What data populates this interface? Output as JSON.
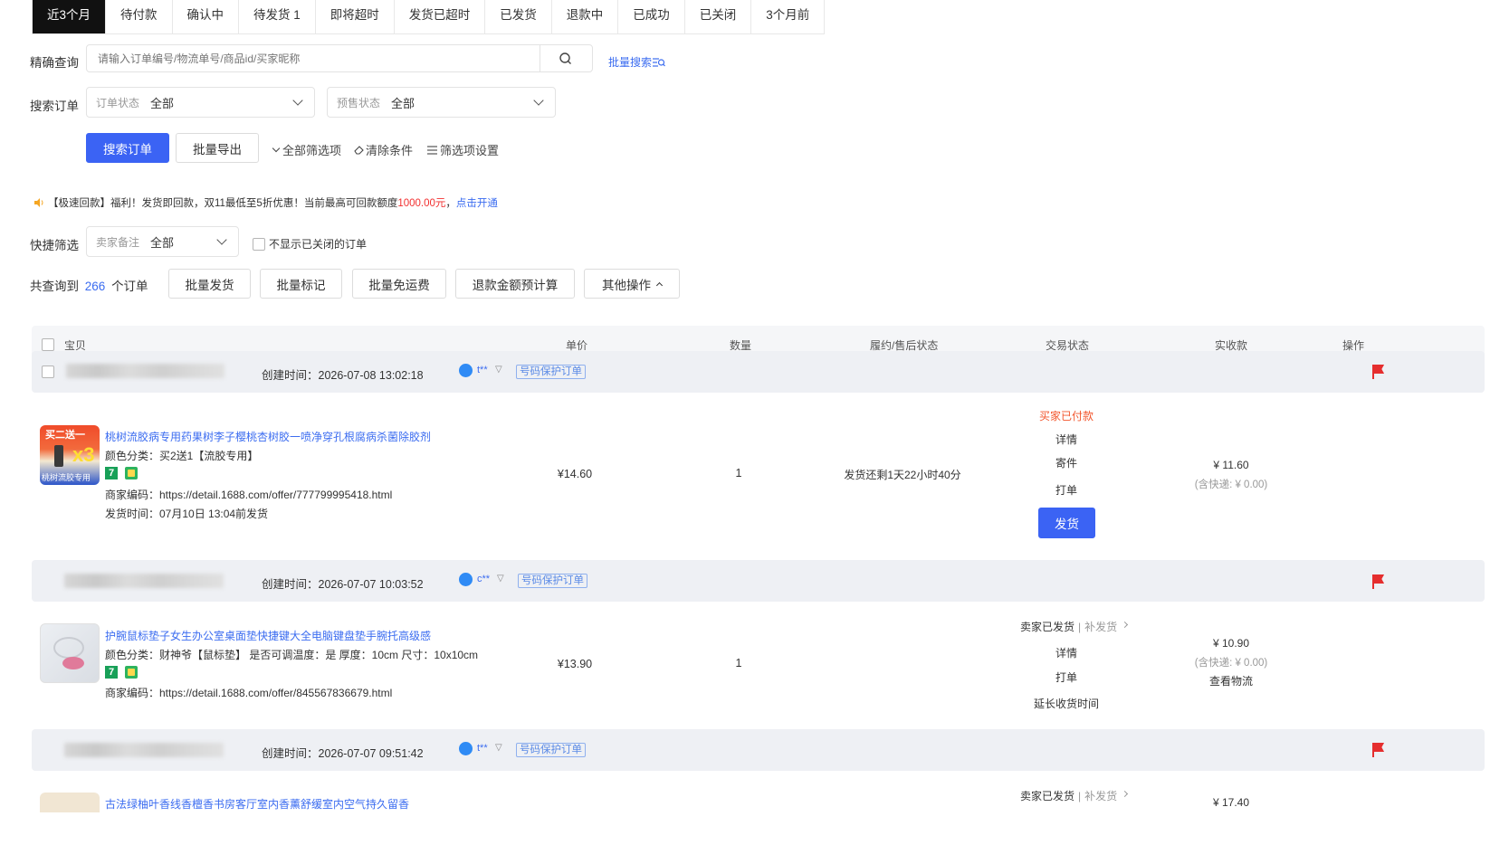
{
  "tabs": [
    {
      "label": "近3个月",
      "active": true
    },
    {
      "label": "待付款"
    },
    {
      "label": "确认中"
    },
    {
      "label": "待发货 1"
    },
    {
      "label": "即将超时"
    },
    {
      "label": "发货已超时"
    },
    {
      "label": "已发货"
    },
    {
      "label": "退款中"
    },
    {
      "label": "已成功"
    },
    {
      "label": "已关闭"
    },
    {
      "label": "3个月前"
    }
  ],
  "search": {
    "label": "精确查询",
    "placeholder": "请输入订单编号/物流单号/商品id/买家昵称",
    "batch_search": "批量搜索"
  },
  "filter": {
    "label": "搜索订单",
    "order_status_label": "订单状态",
    "order_status_value": "全部",
    "presale_label": "预售状态",
    "presale_value": "全部"
  },
  "actions": {
    "search_button": "搜索订单",
    "export_button": "批量导出",
    "all_filters": "全部筛选项",
    "clear": "清除条件",
    "filter_settings": "筛选项设置"
  },
  "notice": {
    "prefix": "【极速回款】福利！发货即回款，双11最低至5折优惠！当前最高可回款额度",
    "amount": "1000.00元",
    "comma": "，",
    "link": "点击开通"
  },
  "quick_filter": {
    "label": "快捷筛选",
    "remark_label": "卖家备注",
    "remark_value": "全部",
    "hide_closed": "不显示已关闭的订单"
  },
  "summary": {
    "prefix": "共查询到",
    "count": "266",
    "suffix": "个订单"
  },
  "bulk": {
    "ship": "批量发货",
    "mark": "批量标记",
    "free_shipping": "批量免运费",
    "refund_calc": "退款金额预计算",
    "other": "其他操作"
  },
  "table_header": {
    "item": "宝贝",
    "price": "单价",
    "qty": "数量",
    "fulfill": "履约/售后状态",
    "trade": "交易状态",
    "paid": "实收款",
    "op": "操作"
  },
  "orders": [
    {
      "created": "创建时间：2026-07-08 13:02:18",
      "buyer": "t**",
      "protect": "号码保护订单",
      "title": "桃树流胶病专用药果树李子樱桃杏树胶一喷净穿孔根腐病杀菌除胶剂",
      "attr": "颜色分类：买2送1【流胶专用】",
      "merchant_code": "商家编码：https://detail.1688.com/offer/777799995418.html",
      "ship_time": "发货时间：07月10日 13:04前发货",
      "price": "¥14.60",
      "qty": "1",
      "fulfill": "发货还剩1天22小时40分",
      "status": "买家已付款",
      "detail": "详情",
      "send": "寄件",
      "print": "打单",
      "ship_btn": "发货",
      "paid": "¥ 11.60",
      "shipping_fee": "(含快递: ¥ 0.00)",
      "img_text_top": "买二送一",
      "img_text_bottom": "桃树流胶专用",
      "img_x": "x3"
    },
    {
      "created": "创建时间：2026-07-07 10:03:52",
      "buyer": "c**",
      "protect": "号码保护订单",
      "title": "护腕鼠标垫子女生办公室桌面垫快捷键大全电脑键盘垫手腕托高级感",
      "attr": "颜色分类：财神爷【鼠标垫】  是否可调温度：是  厚度：10cm  尺寸：10x10cm",
      "merchant_code": "商家编码：https://detail.1688.com/offer/845567836679.html",
      "price": "¥13.90",
      "qty": "1",
      "status": "卖家已发货",
      "resend": "补发货",
      "detail": "详情",
      "print": "打单",
      "extend": "延长收货时间",
      "paid": "¥ 10.90",
      "shipping_fee": "(含快递: ¥ 0.00)",
      "logistics": "查看物流"
    },
    {
      "created": "创建时间：2026-07-07 09:51:42",
      "buyer": "t**",
      "protect": "号码保护订单",
      "title": "古法绿柚叶香线香檀香书房客厅室内香薰舒缓室内空气持久留香",
      "status": "卖家已发货",
      "resend": "补发货",
      "paid": "¥ 17.40"
    }
  ],
  "colors": {
    "primary": "#3b63f4",
    "link": "#3b6cf0",
    "danger": "#f23030",
    "active_tab": "#111111"
  }
}
